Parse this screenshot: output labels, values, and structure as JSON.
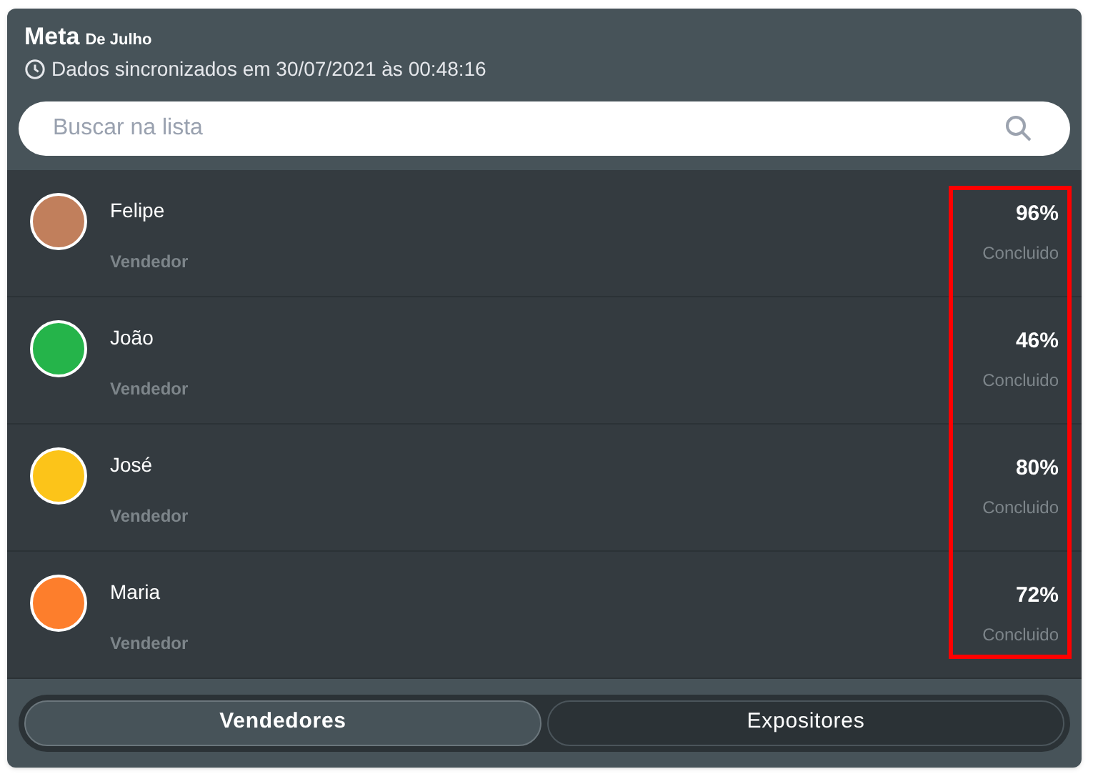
{
  "header": {
    "title": "Meta",
    "subtitle": "De Julho",
    "sync_text": "Dados sincronizados em 30/07/2021 às 00:48:16"
  },
  "search": {
    "placeholder": "Buscar na lista"
  },
  "percent_column_highlighted": true,
  "people": [
    {
      "name": "Felipe",
      "role": "Vendedor",
      "percent": "96%",
      "status": "Concluido",
      "color": "#c17f5c"
    },
    {
      "name": "João",
      "role": "Vendedor",
      "percent": "46%",
      "status": "Concluido",
      "color": "#25b44a"
    },
    {
      "name": "José",
      "role": "Vendedor",
      "percent": "80%",
      "status": "Concluido",
      "color": "#fcc419"
    },
    {
      "name": "Maria",
      "role": "Vendedor",
      "percent": "72%",
      "status": "Concluido",
      "color": "#fd7e2c"
    }
  ],
  "tabs": [
    {
      "label": "Vendedores",
      "selected": true
    },
    {
      "label": "Expositores",
      "selected": false
    }
  ]
}
